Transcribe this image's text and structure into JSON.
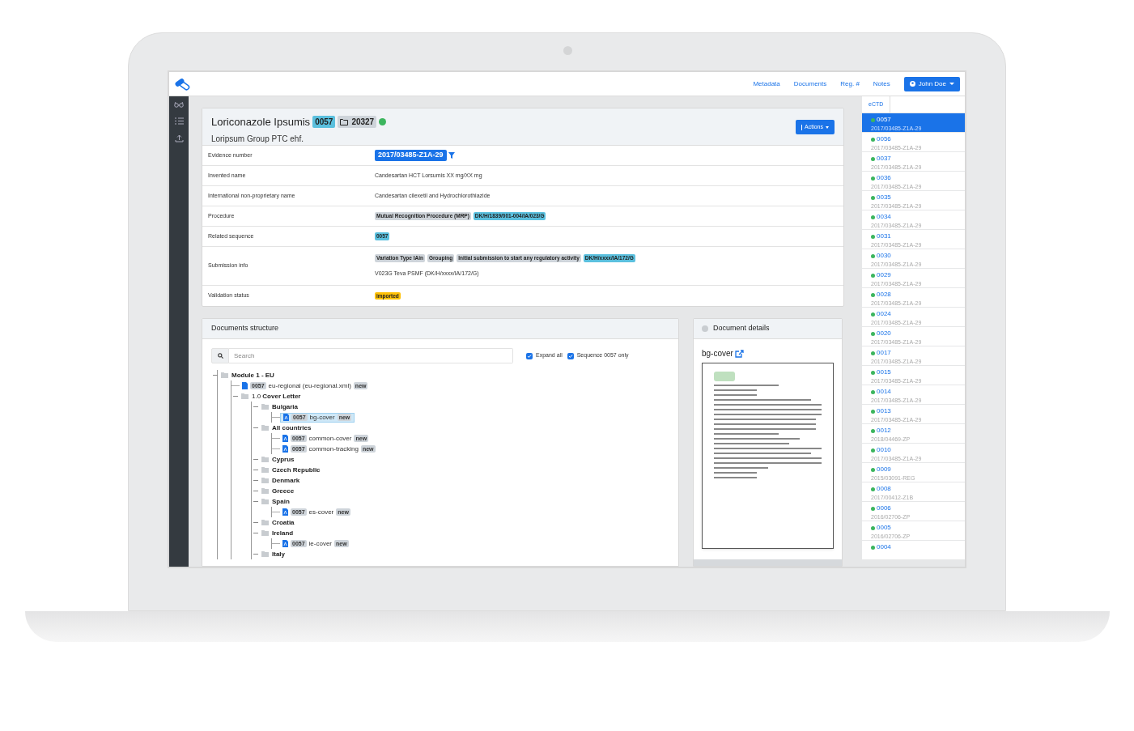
{
  "navbar": {
    "links": [
      "Metadata",
      "Documents",
      "Reg. #",
      "Notes"
    ],
    "user": "John Doe"
  },
  "header": {
    "title": "Loriconazole Ipsumis",
    "sequence": "0057",
    "folder": "20327",
    "subtitle": "Loripsum Group PTC ehf.",
    "actions": "Actions"
  },
  "details": [
    {
      "label": "Evidence number",
      "kind": "evidence",
      "value": "2017/03485-Z1A-29"
    },
    {
      "label": "Invented name",
      "kind": "text",
      "value": "Candesartan HCT Lorsumis XX mg/XX mg"
    },
    {
      "label": "International non-proprietary name",
      "kind": "text",
      "value": "Candesartan cilexetil and Hydrochlorothiazide"
    },
    {
      "label": "Procedure",
      "kind": "tags",
      "tags": [
        {
          "text": "Mutual Recognition Procedure (MRP)",
          "color": "#ced4da"
        },
        {
          "text": "DK/H/1839/001-004/IA/023/G",
          "color": "#5bc0de"
        }
      ]
    },
    {
      "label": "Related sequence",
      "kind": "tags",
      "tags": [
        {
          "text": "0057",
          "color": "#5bc0de"
        }
      ]
    },
    {
      "label": "Submission info",
      "kind": "tags",
      "tags": [
        {
          "text": "Variation Type IAin",
          "color": "#ced4da"
        },
        {
          "text": "Grouping",
          "color": "#ced4da"
        },
        {
          "text": "Initial submission to start any regulatory activity",
          "color": "#ced4da"
        },
        {
          "text": "DK/H/xxxx/IA/172/G",
          "color": "#5bc0de"
        }
      ],
      "note": "V023G Teva PSMF (DK/H/xxxx/IA/172/G)"
    },
    {
      "label": "Validation status",
      "kind": "tags",
      "tags": [
        {
          "text": "imported",
          "color": "#ffc107"
        }
      ]
    }
  ],
  "structure": {
    "title": "Documents structure",
    "search_placeholder": "Search",
    "options": [
      {
        "label": "Expand all",
        "checked": true
      },
      {
        "label": "Sequence 0057 only",
        "checked": true
      }
    ],
    "tree": [
      {
        "kind": "folder",
        "name": "Module 1 - EU",
        "children": [
          {
            "kind": "xml",
            "seq": "0057",
            "name": "eu-regional (eu-regional.xml)",
            "tag": "new",
            "selected": false
          },
          {
            "kind": "folder",
            "name": "1.0 **Cover Letter**",
            "children": [
              {
                "kind": "folder",
                "name": "Bulgaria",
                "children": [
                  {
                    "kind": "pdf",
                    "seq": "0057",
                    "name": "bg-cover",
                    "tag": "new",
                    "selected": true
                  }
                ]
              },
              {
                "kind": "folder",
                "name": "All countries",
                "children": [
                  {
                    "kind": "pdf",
                    "seq": "0057",
                    "name": "common-cover",
                    "tag": "new",
                    "selected": false
                  },
                  {
                    "kind": "pdf",
                    "seq": "0057",
                    "name": "common-tracking",
                    "tag": "new",
                    "selected": false
                  }
                ]
              },
              {
                "kind": "folder",
                "name": "Cyprus"
              },
              {
                "kind": "folder",
                "name": "Czech Republic"
              },
              {
                "kind": "folder",
                "name": "Denmark"
              },
              {
                "kind": "folder",
                "name": "Greece"
              },
              {
                "kind": "folder",
                "name": "Spain",
                "children": [
                  {
                    "kind": "pdf",
                    "seq": "0057",
                    "name": "es-cover",
                    "tag": "new",
                    "selected": false
                  }
                ]
              },
              {
                "kind": "folder",
                "name": "Croatia"
              },
              {
                "kind": "folder",
                "name": "Ireland",
                "children": [
                  {
                    "kind": "pdf",
                    "seq": "0057",
                    "name": "ie-cover",
                    "tag": "new",
                    "selected": false
                  }
                ]
              },
              {
                "kind": "folder",
                "name": "Italy"
              }
            ]
          }
        ]
      }
    ]
  },
  "document_details": {
    "title": "Document details",
    "file": "bg-cover"
  },
  "sequences": {
    "tab": "eCTD",
    "items": [
      {
        "number": "0057",
        "evidence": "2017/03485-Z1A-29",
        "selected": true
      },
      {
        "number": "0056",
        "evidence": "2017/03485-Z1A-29",
        "selected": false
      },
      {
        "number": "0037",
        "evidence": "2017/03485-Z1A-29",
        "selected": false
      },
      {
        "number": "0036",
        "evidence": "2017/03485-Z1A-29",
        "selected": false
      },
      {
        "number": "0035",
        "evidence": "2017/03485-Z1A-29",
        "selected": false
      },
      {
        "number": "0034",
        "evidence": "2017/03485-Z1A-29",
        "selected": false
      },
      {
        "number": "0031",
        "evidence": "2017/03485-Z1A-29",
        "selected": false
      },
      {
        "number": "0030",
        "evidence": "2017/03485-Z1A-29",
        "selected": false
      },
      {
        "number": "0029",
        "evidence": "2017/03485-Z1A-29",
        "selected": false
      },
      {
        "number": "0028",
        "evidence": "2017/03485-Z1A-29",
        "selected": false
      },
      {
        "number": "0024",
        "evidence": "2017/03485-Z1A-29",
        "selected": false
      },
      {
        "number": "0020",
        "evidence": "2017/03485-Z1A-29",
        "selected": false
      },
      {
        "number": "0017",
        "evidence": "2017/03485-Z1A-29",
        "selected": false
      },
      {
        "number": "0015",
        "evidence": "2017/03485-Z1A-29",
        "selected": false
      },
      {
        "number": "0014",
        "evidence": "2017/03485-Z1A-29",
        "selected": false
      },
      {
        "number": "0013",
        "evidence": "2017/03485-Z1A-29",
        "selected": false
      },
      {
        "number": "0012",
        "evidence": "2018/04469-ZP",
        "selected": false
      },
      {
        "number": "0010",
        "evidence": "2017/03485-Z1A-29",
        "selected": false
      },
      {
        "number": "0009",
        "evidence": "2015/03091-REG",
        "selected": false
      },
      {
        "number": "0008",
        "evidence": "2017/00412-Z1B",
        "selected": false
      },
      {
        "number": "0006",
        "evidence": "2016/02706-ZP",
        "selected": false
      },
      {
        "number": "0005",
        "evidence": "2016/02706-ZP",
        "selected": false
      },
      {
        "number": "0004",
        "selected": false
      }
    ]
  }
}
